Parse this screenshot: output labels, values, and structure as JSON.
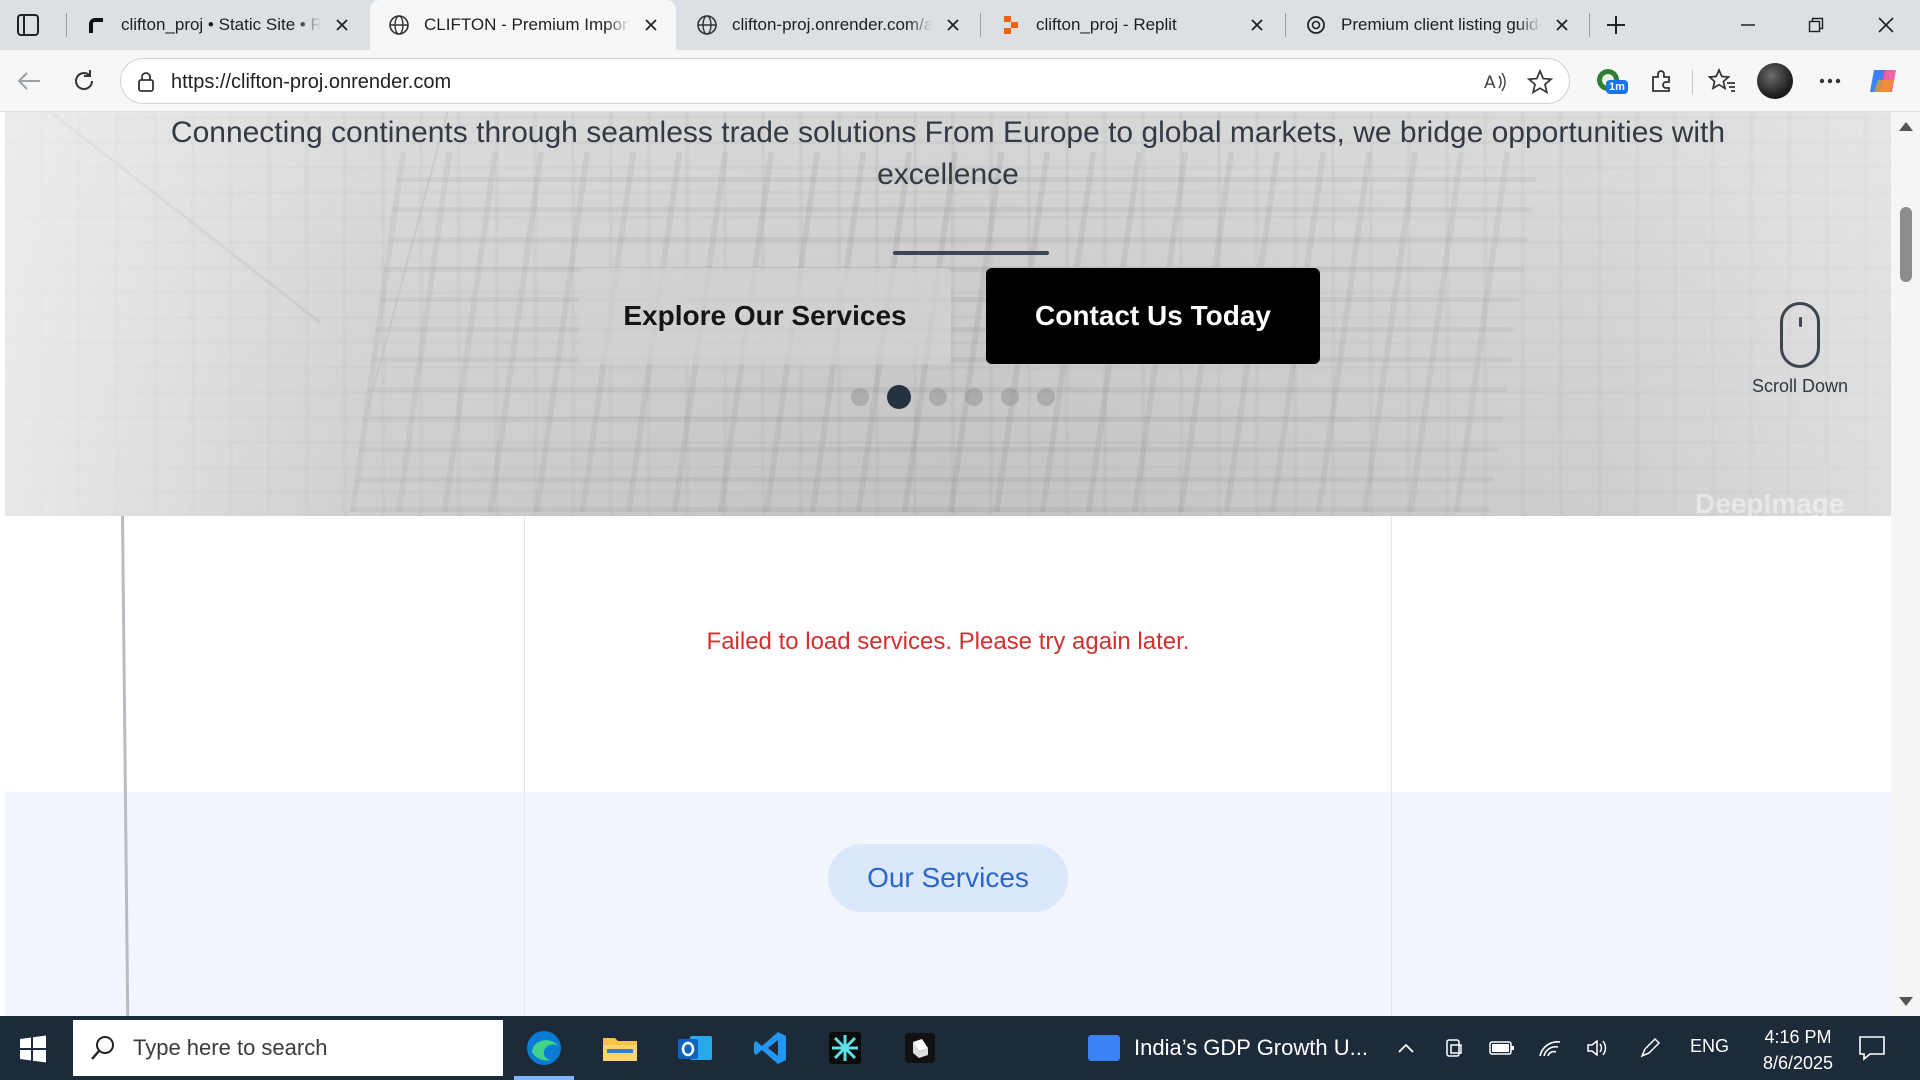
{
  "browser": {
    "tabs": [
      {
        "title": "clifton_proj • Static Site • Render",
        "favicon": "render-icon",
        "active": false
      },
      {
        "title": "CLIFTON - Premium Import & Export",
        "favicon": "globe-icon",
        "active": true
      },
      {
        "title": "clifton-proj.onrender.com/api",
        "favicon": "globe-icon",
        "active": false
      },
      {
        "title": "clifton_proj - Replit",
        "favicon": "replit-icon",
        "active": false
      },
      {
        "title": "Premium client listing guide",
        "favicon": "chatgpt-icon",
        "active": false
      }
    ],
    "address_bar": {
      "url": "https://clifton-proj.onrender.com"
    },
    "extension_badge": "1m"
  },
  "page": {
    "hero": {
      "subtitle": "Connecting continents through seamless trade solutions From Europe to global markets, we bridge opportunities with excellence",
      "buttons": {
        "explore": "Explore Our Services",
        "contact": "Contact Us Today"
      },
      "carousel": {
        "slide_count": 6,
        "active_index": 1
      },
      "scroll_hint": "Scroll Down",
      "watermark": "DeepImage"
    },
    "services": {
      "error_message": "Failed to load services. Please try again later.",
      "section_label": "Our Services"
    }
  },
  "taskbar": {
    "search_placeholder": "Type here to search",
    "apps": [
      "edge-icon",
      "file-explorer-icon",
      "outlook-icon",
      "vscode-icon",
      "cursor-icon",
      "roblox-icon"
    ],
    "news_widget": "India’s GDP Growth U...",
    "language": "ENG",
    "time": "4:16 PM",
    "date": "8/6/2025"
  },
  "colors": {
    "error": "#d32f2f",
    "pill_bg": "#dbe8fb",
    "pill_text": "#2b67c9",
    "taskbar": "#1c2a3a"
  }
}
